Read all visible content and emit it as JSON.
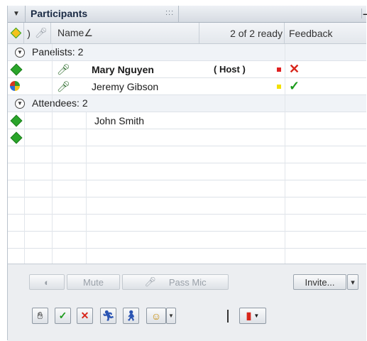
{
  "panel": {
    "title": "Participants",
    "grip": ":::",
    "minimize": "–"
  },
  "header": {
    "name_col": "Name∠",
    "ready_status": "2 of 2 ready",
    "feedback_col": "Feedback"
  },
  "groups": [
    {
      "label": "Panelists: 2",
      "toggle": "▼"
    },
    {
      "label": "Attendees: 2",
      "toggle": "▼"
    }
  ],
  "panelists": [
    {
      "name": "Mary Nguyen",
      "role": "( Host )",
      "status_color": "#e02020",
      "feedback": "✕"
    },
    {
      "name": "Jeremy Gibson",
      "role": "",
      "status_color": "#f2e000",
      "feedback": "✓"
    }
  ],
  "attendees": [
    {
      "name": "John Smith"
    },
    {
      "name": ""
    }
  ],
  "toolbar": {
    "mute_label": "Mute",
    "pass_mic_label": "Pass Mic",
    "invite_label": "Invite...",
    "invite_dropdown": "▾"
  },
  "colors": {
    "presence_green": "#2aa52a",
    "feedback_no": "#d8261b",
    "feedback_yes": "#1b9a1b"
  },
  "icons": {
    "panel_collapse": "down-triangle-icon",
    "mic": "microphone-icon",
    "presence": "green-diamond-icon",
    "feedback_no": "red-x-icon",
    "feedback_yes": "green-check-icon"
  }
}
